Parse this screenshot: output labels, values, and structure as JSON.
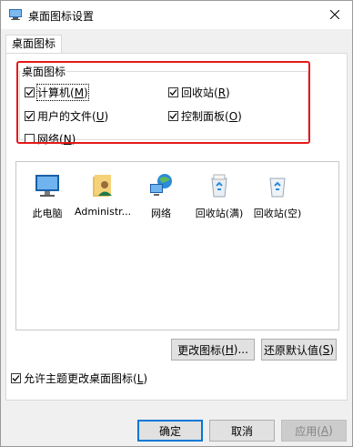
{
  "window": {
    "title": "桌面图标设置"
  },
  "tabs": [
    {
      "label": "桌面图标"
    }
  ],
  "desktop_icons_group": {
    "label": "桌面图标",
    "checkboxes": [
      {
        "label": "计算机(",
        "accel": "M",
        "suffix": ")",
        "checked": true
      },
      {
        "label": "回收站(",
        "accel": "R",
        "suffix": ")",
        "checked": true
      },
      {
        "label": "用户的文件(",
        "accel": "U",
        "suffix": ")",
        "checked": true
      },
      {
        "label": "控制面板(",
        "accel": "O",
        "suffix": ")",
        "checked": true
      },
      {
        "label": "网络(",
        "accel": "N",
        "suffix": ")",
        "checked": false
      }
    ]
  },
  "icon_list": [
    {
      "label": "此电脑",
      "icon": "computer-icon"
    },
    {
      "label": "Administr...",
      "icon": "user-folder-icon"
    },
    {
      "label": "网络",
      "icon": "network-icon"
    },
    {
      "label": "回收站(满)",
      "icon": "recycle-bin-full-icon"
    },
    {
      "label": "回收站(空)",
      "icon": "recycle-bin-empty-icon"
    }
  ],
  "buttons": {
    "change_icon": {
      "label": "更改图标(",
      "accel": "H",
      "suffix": ")..."
    },
    "restore_default": {
      "label": "还原默认值(",
      "accel": "S",
      "suffix": ")"
    },
    "ok": {
      "label": "确定"
    },
    "cancel": {
      "label": "取消"
    },
    "apply": {
      "label": "应用(",
      "accel": "A",
      "suffix": ")"
    }
  },
  "allow_themes": {
    "label": "允许主题更改桌面图标(",
    "accel": "L",
    "suffix": ")",
    "checked": true
  },
  "colors": {
    "highlight_box": "#e51919",
    "primary_border": "#0078d7"
  }
}
